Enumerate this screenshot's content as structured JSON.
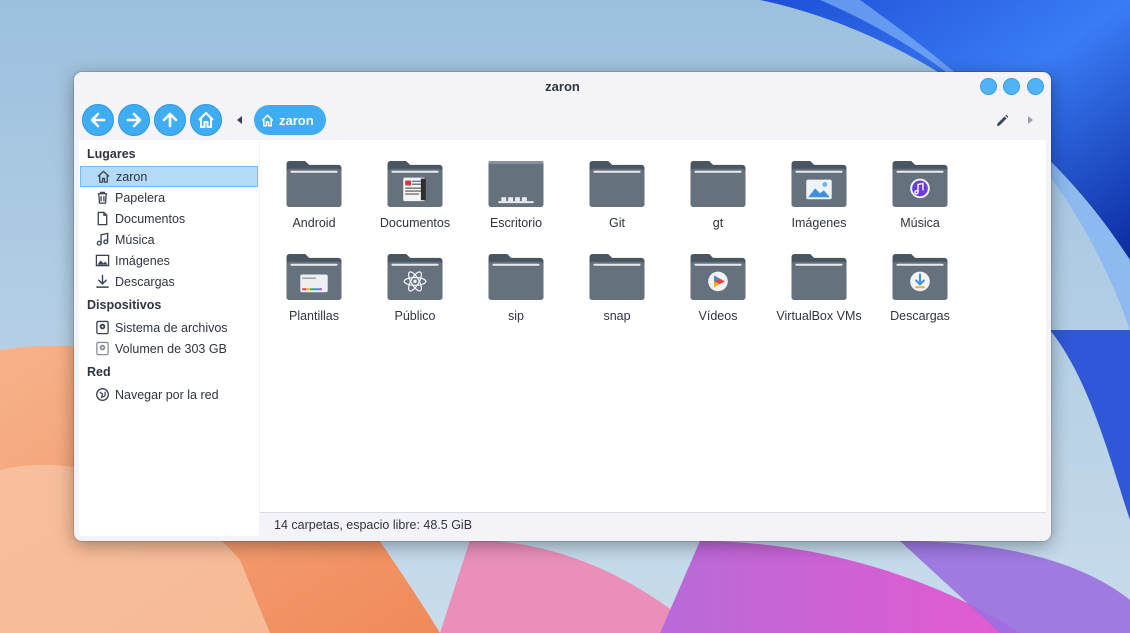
{
  "window": {
    "title": "zaron"
  },
  "toolbar": {
    "back_icon": "arrow-left-icon",
    "forward_icon": "arrow-right-icon",
    "up_icon": "arrow-up-icon",
    "home_icon": "home-icon",
    "breadcrumb": "zaron"
  },
  "sidebar": {
    "sections": [
      {
        "title": "Lugares",
        "items": [
          {
            "label": "zaron",
            "icon": "home-icon",
            "selected": true
          },
          {
            "label": "Papelera",
            "icon": "trash-icon"
          },
          {
            "label": "Documentos",
            "icon": "document-icon"
          },
          {
            "label": "Música",
            "icon": "music-icon"
          },
          {
            "label": "Imágenes",
            "icon": "image-icon"
          },
          {
            "label": "Descargas",
            "icon": "download-icon"
          }
        ]
      },
      {
        "title": "Dispositivos",
        "items": [
          {
            "label": "Sistema de archivos",
            "icon": "drive-icon"
          },
          {
            "label": "Volumen de 303 GB",
            "icon": "drive-icon"
          }
        ]
      },
      {
        "title": "Red",
        "items": [
          {
            "label": "Navegar por la red",
            "icon": "network-icon"
          }
        ]
      }
    ]
  },
  "files": [
    {
      "name": "Android",
      "icon": "folder-icon"
    },
    {
      "name": "Documentos",
      "icon": "folder-documents-icon"
    },
    {
      "name": "Escritorio",
      "icon": "folder-desktop-icon"
    },
    {
      "name": "Git",
      "icon": "folder-icon"
    },
    {
      "name": "gt",
      "icon": "folder-icon"
    },
    {
      "name": "Imágenes",
      "icon": "folder-pictures-icon"
    },
    {
      "name": "Música",
      "icon": "folder-music-icon"
    },
    {
      "name": "Plantillas",
      "icon": "folder-templates-icon"
    },
    {
      "name": "Público",
      "icon": "folder-public-icon"
    },
    {
      "name": "sip",
      "icon": "folder-icon"
    },
    {
      "name": "snap",
      "icon": "folder-icon"
    },
    {
      "name": "Vídeos",
      "icon": "folder-videos-icon"
    },
    {
      "name": "VirtualBox VMs",
      "icon": "folder-icon"
    },
    {
      "name": "Descargas",
      "icon": "folder-download-icon"
    }
  ],
  "status": {
    "text": "14 carpetas, espacio libre: 48.5 GiB"
  },
  "colors": {
    "accent": "#40acf3",
    "selected": "#b3dbf8",
    "folder": "#5e6a78"
  }
}
